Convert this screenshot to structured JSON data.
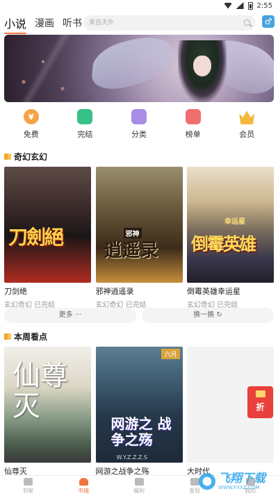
{
  "status_bar": {
    "time": "2:55"
  },
  "top_nav": {
    "tabs": [
      {
        "label": "小说",
        "active": true
      },
      {
        "label": "漫画",
        "active": false
      },
      {
        "label": "听书",
        "active": false
      }
    ],
    "search_placeholder": "来自天外",
    "gender_icon": "male-symbol-icon",
    "gender_symbol": "♂"
  },
  "banner": {
    "description_icon": "anime-girl-banner"
  },
  "quick_menu": [
    {
      "label": "免费",
      "icon": "coin-icon",
      "glyph": "¥"
    },
    {
      "label": "完结",
      "icon": "book-icon",
      "glyph": ""
    },
    {
      "label": "分类",
      "icon": "document-icon",
      "glyph": ""
    },
    {
      "label": "榜单",
      "icon": "ranking-icon",
      "glyph": ""
    },
    {
      "label": "会员",
      "icon": "crown-icon",
      "glyph": ""
    }
  ],
  "section1": {
    "title": "奇幻玄幻",
    "books": [
      {
        "title": "刀剑绝",
        "meta": "玄幻奇幻 已完结",
        "cover_text": "刀劍絕"
      },
      {
        "title": "邪神逍遥录",
        "meta": "玄幻奇幻 已完结",
        "cover_text": "逍遥录",
        "cover_badge": "邪神"
      },
      {
        "title": "倒霉英雄幸运星",
        "meta": "玄幻奇幻 已完结",
        "cover_text": "倒霉英雄",
        "cover_badge": "幸运星"
      }
    ],
    "more_label": "更多 ···",
    "refresh_label": "换一换 ↻"
  },
  "section2": {
    "title": "本周看点",
    "books": [
      {
        "title": "仙尊灭",
        "cover_text": "仙尊灭"
      },
      {
        "title": "网游之战争之殇",
        "cover_text": "网游之 战争之殇",
        "cover_sub": "W.Y.Z.Z.Z.S",
        "cover_tag": "六月"
      },
      {
        "title": "大时代",
        "cover_text": ""
      }
    ]
  },
  "coupon": {
    "label": "折"
  },
  "bottom_nav": [
    {
      "label": "书架",
      "active": false
    },
    {
      "label": "书城",
      "active": true
    },
    {
      "label": "福利",
      "active": false
    },
    {
      "label": "发现",
      "active": false
    },
    {
      "label": "我的",
      "active": false
    }
  ],
  "watermark": {
    "text": "飞翔下载",
    "url": "WWW.FXXZ.COM"
  }
}
